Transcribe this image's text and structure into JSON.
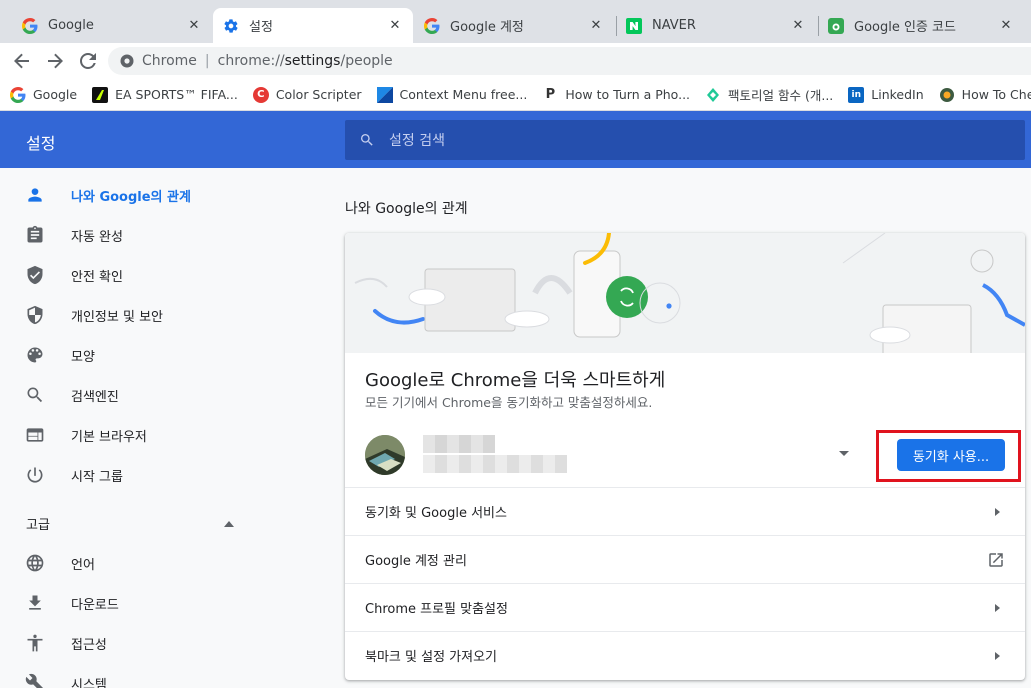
{
  "tabs": [
    {
      "title": "Google",
      "icon": "google-g-icon",
      "active": false
    },
    {
      "title": "설정",
      "icon": "settings-gear-icon",
      "active": true
    },
    {
      "title": "Google 계정",
      "icon": "google-g-icon",
      "active": false
    },
    {
      "title": "NAVER",
      "icon": "naver-n-icon",
      "active": false
    },
    {
      "title": "Google 인증 코드",
      "icon": "authenticator-icon",
      "active": false
    }
  ],
  "tab_close": "✕",
  "omnibox": {
    "chip": "Chrome",
    "divider": "|",
    "url_scheme": "chrome://",
    "url_host": "settings",
    "url_path": "/people"
  },
  "bookmarks": [
    {
      "label": "Google",
      "icon": "google-g-icon"
    },
    {
      "label": "EA SPORTS™ FIFA...",
      "icon": "ea-fifa-icon"
    },
    {
      "label": "Color Scripter",
      "icon": "color-scripter-icon"
    },
    {
      "label": "Context Menu free...",
      "icon": "context-menu-icon"
    },
    {
      "label": "How to Turn a Pho...",
      "icon": "p-icon"
    },
    {
      "label": "팩토리얼 함수 (개...",
      "icon": "factorial-icon"
    },
    {
      "label": "LinkedIn",
      "icon": "linkedin-icon"
    },
    {
      "label": "How To Check Ub...",
      "icon": "ubuntu-check-icon"
    }
  ],
  "settings_header": {
    "title": "설정",
    "search_placeholder": "설정 검색"
  },
  "sidebar": {
    "items": [
      {
        "label": "나와 Google의 관계",
        "icon": "person-icon",
        "active": true
      },
      {
        "label": "자동 완성",
        "icon": "clipboard-icon",
        "active": false
      },
      {
        "label": "안전 확인",
        "icon": "shield-check-icon",
        "active": false
      },
      {
        "label": "개인정보 및 보안",
        "icon": "shield-half-icon",
        "active": false
      },
      {
        "label": "모양",
        "icon": "palette-icon",
        "active": false
      },
      {
        "label": "검색엔진",
        "icon": "search-icon",
        "active": false
      },
      {
        "label": "기본 브라우저",
        "icon": "browser-window-icon",
        "active": false
      },
      {
        "label": "시작 그룹",
        "icon": "power-icon",
        "active": false
      }
    ],
    "advanced_label": "고급",
    "advanced_items": [
      {
        "label": "언어",
        "icon": "globe-icon"
      },
      {
        "label": "다운로드",
        "icon": "download-icon"
      },
      {
        "label": "접근성",
        "icon": "accessibility-icon"
      },
      {
        "label": "시스템",
        "icon": "wrench-icon"
      }
    ]
  },
  "main": {
    "section_title": "나와 Google의 관계",
    "promo_title": "Google로 Chrome을 더욱 스마트하게",
    "promo_subtitle": "모든 기기에서 Chrome을 동기화하고 맞춤설정하세요.",
    "sync_button": "동기화 사용...",
    "rows": [
      {
        "label": "동기화 및 Google 서비스",
        "trailing": "arrow"
      },
      {
        "label": "Google 계정 관리",
        "trailing": "external-link"
      },
      {
        "label": "Chrome 프로필 맞춤설정",
        "trailing": "arrow"
      },
      {
        "label": "북마크 및 설정 가져오기",
        "trailing": "arrow"
      }
    ]
  },
  "colors": {
    "header_blue": "#3367d6",
    "accent_blue": "#1a73e8",
    "highlight_red": "#e0131e",
    "sync_green": "#34a853"
  }
}
